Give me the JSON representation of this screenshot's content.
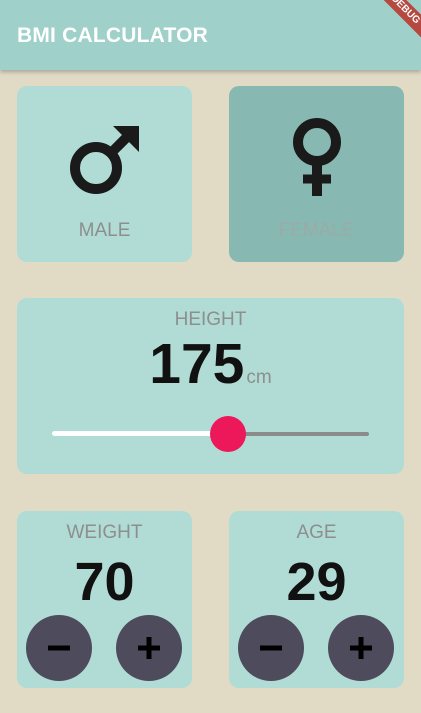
{
  "app": {
    "title": "BMI CALCULATOR",
    "debug_banner": "DEBUG"
  },
  "gender": {
    "male": {
      "label": "MALE",
      "icon": "male-icon",
      "selected": false
    },
    "female": {
      "label": "FEMALE",
      "icon": "female-icon",
      "selected": true
    }
  },
  "height": {
    "title": "HEIGHT",
    "value": "175",
    "unit": "cm",
    "slider_fraction": 0.56
  },
  "weight": {
    "title": "WEIGHT",
    "value": "70",
    "minus_icon": "minus-icon",
    "plus_icon": "plus-icon"
  },
  "age": {
    "title": "AGE",
    "value": "29",
    "minus_icon": "minus-icon",
    "plus_icon": "plus-icon"
  },
  "colors": {
    "background": "#e1dbc6",
    "appbar": "#9fd0c9",
    "card": "#b0dcd5",
    "card_selected": "#87b8b1",
    "slider_thumb": "#ec1859",
    "button": "#4d4b5c"
  }
}
